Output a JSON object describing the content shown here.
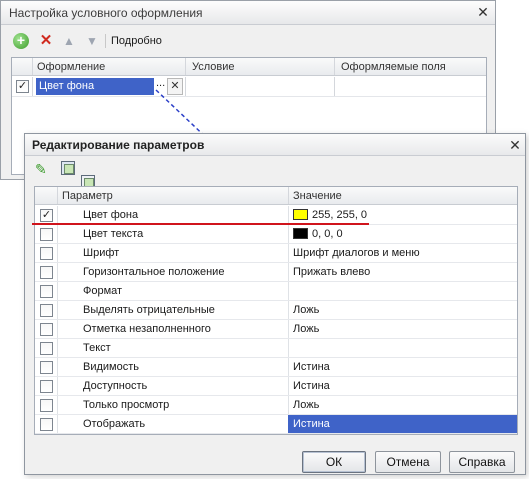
{
  "window1": {
    "title": "Настройка условного оформления",
    "close_glyph": "✕",
    "toolbar": {
      "icons": [
        "add-icon",
        "delete-icon",
        "move-up-icon",
        "move-down-icon"
      ],
      "details_label": "Подробно"
    },
    "columns": [
      "Оформление",
      "Условие",
      "Оформляемые поля"
    ],
    "row": {
      "checked": true,
      "appearance": "Цвет фона",
      "condition": "",
      "fields": ""
    }
  },
  "window2": {
    "title": "Редактирование параметров",
    "close_glyph": "✕",
    "toolbar": {
      "icons": [
        "edit-icon",
        "check-all-icon",
        "uncheck-all-icon"
      ]
    },
    "columns": {
      "param": "Параметр",
      "value": "Значение"
    },
    "rows": [
      {
        "checked": true,
        "param": "Цвет фона",
        "value": "255, 255, 0",
        "swatch": "#ffff00"
      },
      {
        "checked": false,
        "param": "Цвет текста",
        "value": "0, 0, 0",
        "swatch": "#000000"
      },
      {
        "checked": false,
        "param": "Шрифт",
        "value": "Шрифт диалогов и меню"
      },
      {
        "checked": false,
        "param": "Горизонтальное положение",
        "value": "Прижать влево"
      },
      {
        "checked": false,
        "param": "Формат",
        "value": ""
      },
      {
        "checked": false,
        "param": "Выделять отрицательные",
        "value": "Ложь"
      },
      {
        "checked": false,
        "param": "Отметка незаполненного",
        "value": "Ложь"
      },
      {
        "checked": false,
        "param": "Текст",
        "value": ""
      },
      {
        "checked": false,
        "param": "Видимость",
        "value": "Истина"
      },
      {
        "checked": false,
        "param": "Доступность",
        "value": "Истина"
      },
      {
        "checked": false,
        "param": "Только просмотр",
        "value": "Ложь"
      },
      {
        "checked": false,
        "param": "Отображать",
        "value": "Истина",
        "selected": true
      }
    ],
    "buttons": {
      "ok": "ОК",
      "cancel": "Отмена",
      "help": "Справка"
    }
  },
  "colors": {
    "selection": "#3f63c8",
    "highlight_line": "#d0141c",
    "connector": "#2b3fc8"
  }
}
